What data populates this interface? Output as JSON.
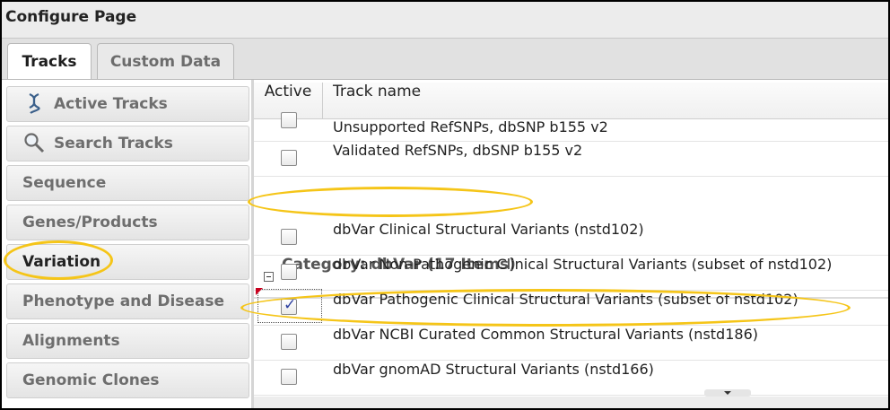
{
  "window": {
    "title": "Configure Page"
  },
  "tabs": [
    {
      "label": "Tracks",
      "active": true
    },
    {
      "label": "Custom Data",
      "active": false
    }
  ],
  "sidebar": {
    "items": [
      {
        "label": "Active Tracks",
        "icon": "dna-helix-icon"
      },
      {
        "label": "Search Tracks",
        "icon": "magnifier-icon"
      },
      {
        "label": "Sequence"
      },
      {
        "label": "Genes/Products"
      },
      {
        "label": "Variation",
        "selected": true
      },
      {
        "label": "Phenotype and Disease"
      },
      {
        "label": "Alignments"
      },
      {
        "label": "Genomic Clones"
      }
    ]
  },
  "grid": {
    "columns": {
      "active": "Active",
      "name": "Track name"
    },
    "rows_before": [
      {
        "name": "Unsupported RefSNPs, dbSNP b155 v2",
        "checked": false
      },
      {
        "name": "Validated RefSNPs, dbSNP b155 v2",
        "checked": false
      }
    ],
    "category": {
      "label": "Category: dbVar (17 Items)",
      "expanded": true
    },
    "rows": [
      {
        "name": "dbVar Clinical Structural Variants (nstd102)",
        "checked": false
      },
      {
        "name": "dbVar Non-Pathogenic Clinical Structural Variants (subset of nstd102)",
        "checked": false
      },
      {
        "name": "dbVar Pathogenic Clinical Structural Variants (subset of nstd102)",
        "checked": true
      },
      {
        "name": "dbVar NCBI Curated Common Structural Variants (nstd186)",
        "checked": false
      },
      {
        "name": "dbVar gnomAD Structural Variants (nstd166)",
        "checked": false
      }
    ]
  },
  "colors": {
    "highlight": "#f5c518",
    "check": "#2c3fa0"
  }
}
